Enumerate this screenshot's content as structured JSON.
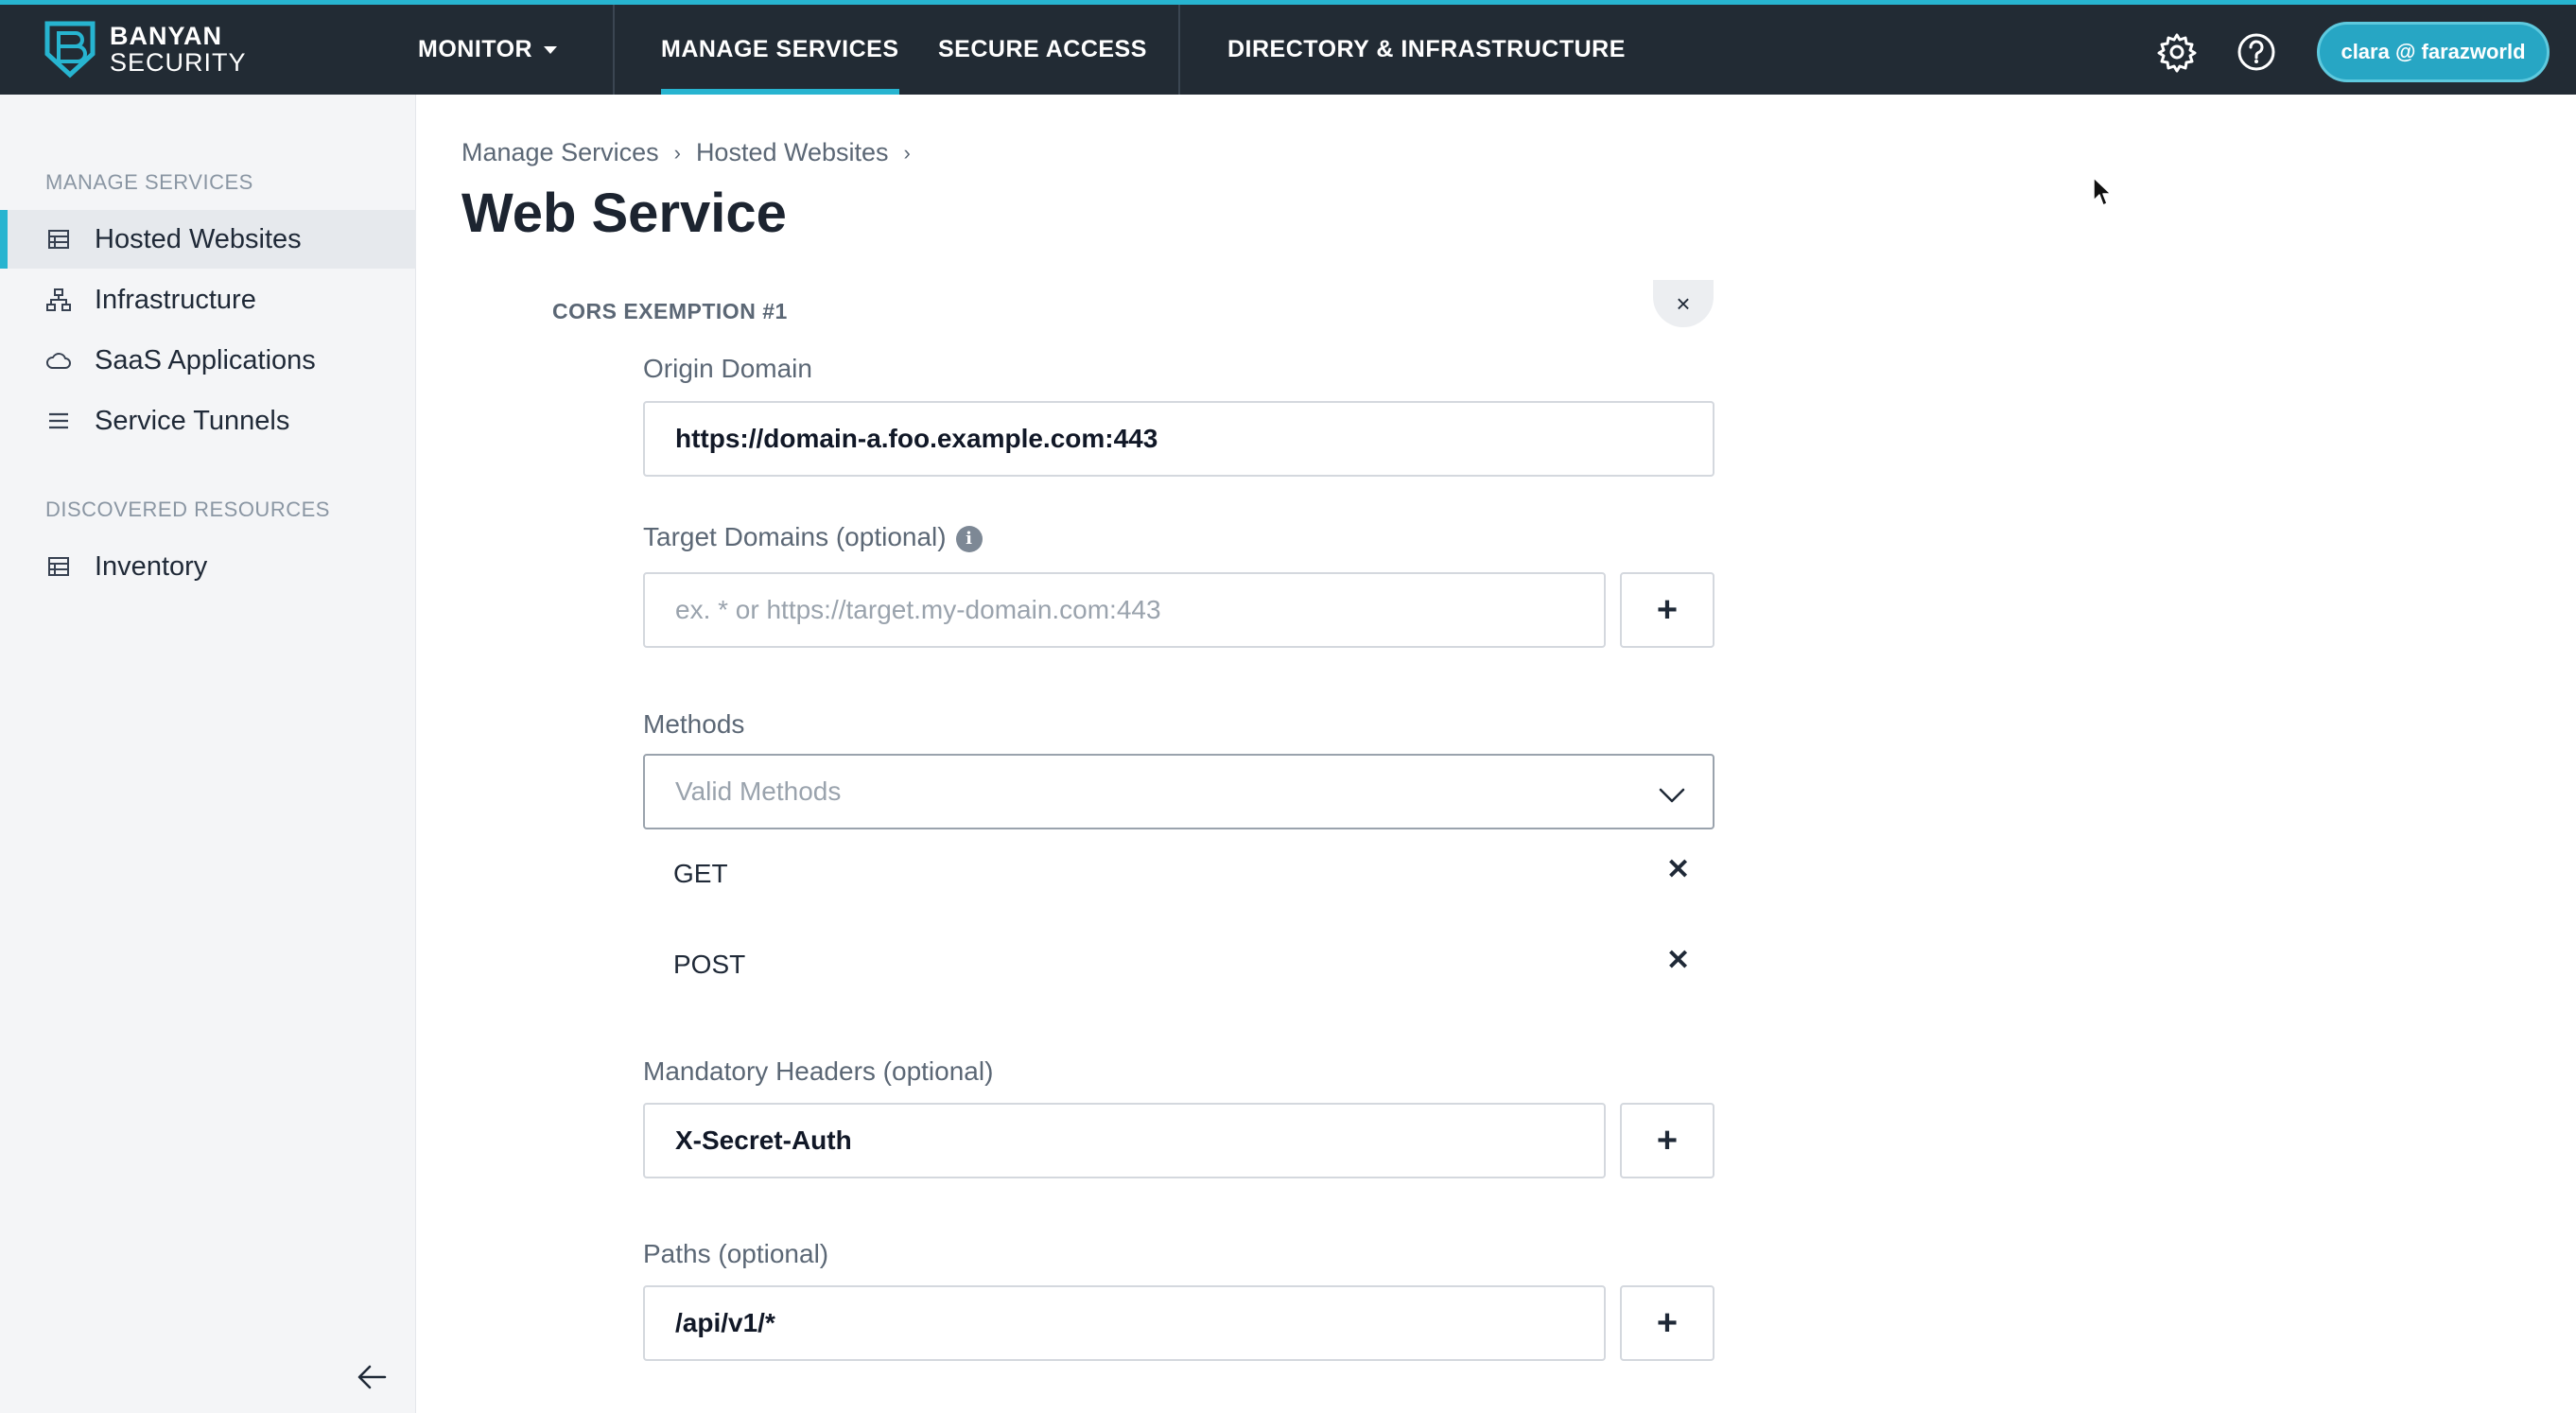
{
  "brand": {
    "line1": "BANYAN",
    "line2": "SECURITY"
  },
  "nav": {
    "monitor": "MONITOR",
    "manage_services": "MANAGE SERVICES",
    "secure_access": "SECURE ACCESS",
    "directory": "DIRECTORY & INFRASTRUCTURE"
  },
  "user": {
    "label": "clara @ farazworld"
  },
  "sidebar": {
    "heading_manage": "MANAGE SERVICES",
    "items": [
      {
        "label": "Hosted Websites",
        "icon": "table-icon",
        "active": true
      },
      {
        "label": "Infrastructure",
        "icon": "network-icon",
        "active": false
      },
      {
        "label": "SaaS Applications",
        "icon": "cloud-icon",
        "active": false
      },
      {
        "label": "Service Tunnels",
        "icon": "list-icon",
        "active": false
      }
    ],
    "heading_discovered": "DISCOVERED RESOURCES",
    "inventory": {
      "label": "Inventory",
      "icon": "table-icon"
    }
  },
  "breadcrumb": {
    "level1": "Manage Services",
    "level2": "Hosted Websites"
  },
  "page": {
    "title": "Web Service"
  },
  "cors": {
    "section_title": "CORS EXEMPTION #1",
    "remove_symbol": "×",
    "origin": {
      "label": "Origin Domain",
      "value": "https://domain-a.foo.example.com:443"
    },
    "target": {
      "label": "Target Domains (optional)",
      "placeholder": "ex. * or https://target.my-domain.com:443",
      "info_symbol": "i"
    },
    "methods": {
      "label": "Methods",
      "placeholder": "Valid Methods",
      "selected": [
        "GET",
        "POST"
      ]
    },
    "headers": {
      "label": "Mandatory Headers (optional)",
      "value": "X-Secret-Auth"
    },
    "paths": {
      "label": "Paths (optional)",
      "value": "/api/v1/*"
    },
    "add_symbol": "+",
    "remove_item_symbol": "✕"
  }
}
